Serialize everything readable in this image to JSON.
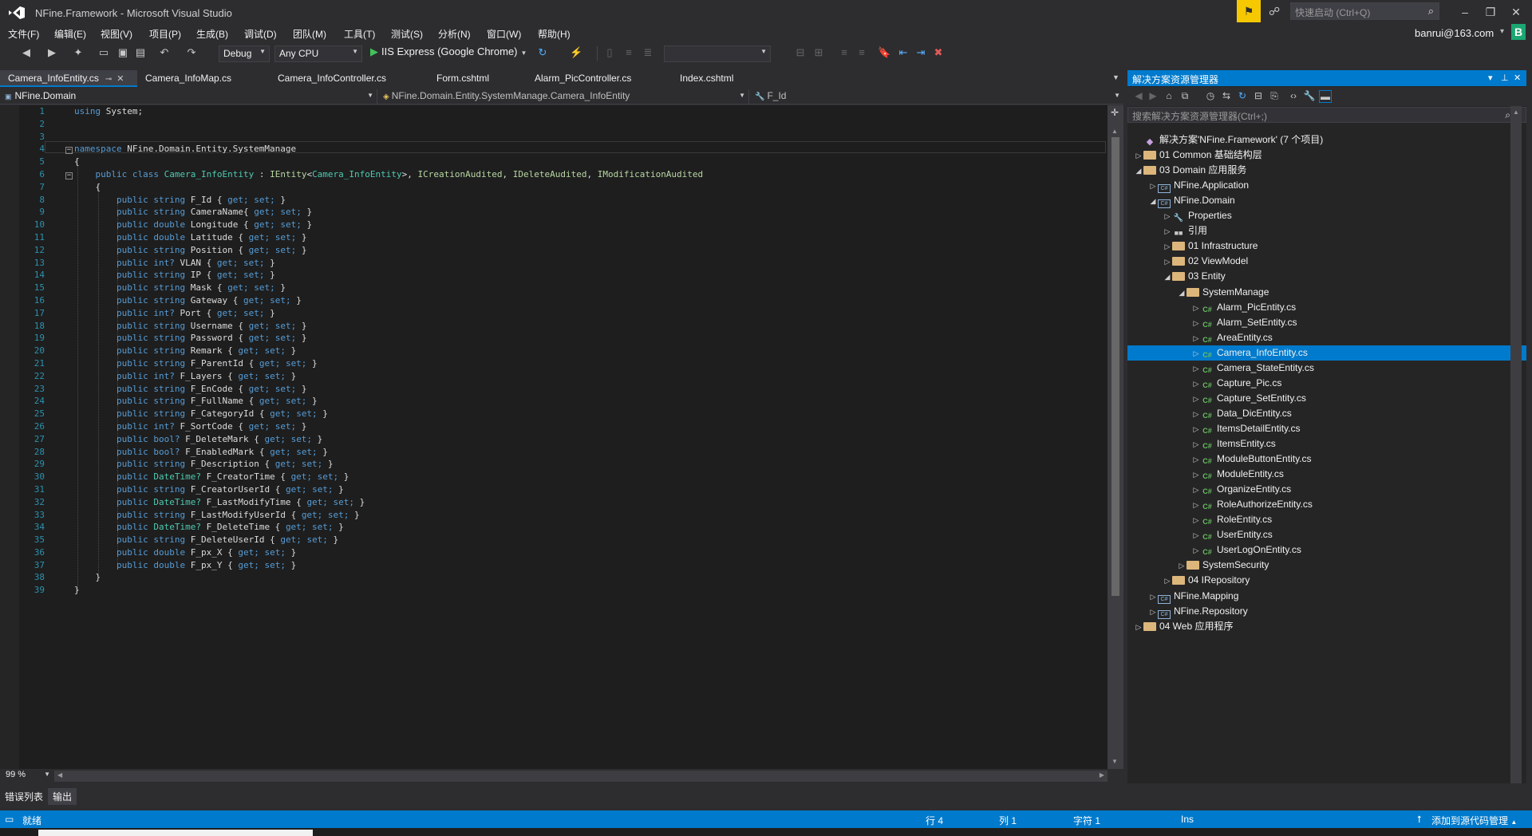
{
  "window": {
    "title": "NFine.Framework - Microsoft Visual Studio",
    "quick_launch_placeholder": "快速启动 (Ctrl+Q)",
    "account": "banrui@163.com",
    "avatar_letter": "B"
  },
  "menu": [
    "文件(F)",
    "编辑(E)",
    "视图(V)",
    "项目(P)",
    "生成(B)",
    "调试(D)",
    "团队(M)",
    "工具(T)",
    "测试(S)",
    "分析(N)",
    "窗口(W)",
    "帮助(H)"
  ],
  "toolbar": {
    "config": "Debug",
    "platform": "Any CPU",
    "run_target": "IIS Express (Google Chrome)"
  },
  "tabs": [
    "Camera_InfoEntity.cs",
    "Camera_InfoMap.cs",
    "Camera_InfoController.cs",
    "Form.cshtml",
    "Alarm_PicController.cs",
    "Index.cshtml"
  ],
  "navbar": {
    "project": "NFine.Domain",
    "type": "NFine.Domain.Entity.SystemManage.Camera_InfoEntity",
    "member": "F_Id"
  },
  "code": {
    "line_numbers": [
      "1",
      "2",
      "3",
      "4",
      "5",
      "6",
      "7",
      "8",
      "9",
      "10",
      "11",
      "12",
      "13",
      "14",
      "15",
      "16",
      "17",
      "18",
      "19",
      "20",
      "21",
      "22",
      "23",
      "24",
      "25",
      "26",
      "27",
      "28",
      "29",
      "30",
      "31",
      "32",
      "33",
      "34",
      "35",
      "36",
      "37",
      "38",
      "39"
    ],
    "using_kw": "using",
    "using_rest": " System;",
    "ns_kw": "namespace",
    "ns_name": " NFine.Domain.Entity.SystemManage",
    "open_brace": "{",
    "close_brace": "}",
    "class_mod": "public class",
    "class_name": "Camera_InfoEntity",
    "class_colon": " : ",
    "i_entity": "IEntity",
    "generic_open": "<",
    "generic_arg": "Camera_InfoEntity",
    "generic_close": ">, ",
    "i_creation": "ICreationAudited",
    "comma1": ", ",
    "i_delete": "IDeleteAudited",
    "comma2": ", ",
    "i_modification": "IModificationAudited",
    "properties": [
      {
        "type": "string",
        "name": "F_Id { ",
        "accessors": "get; set;",
        "end": " }"
      },
      {
        "type": "string",
        "name": "CameraName{ ",
        "accessors": "get; set;",
        "end": " }"
      },
      {
        "type": "double",
        "name": "Longitude { ",
        "accessors": "get; set;",
        "end": " }"
      },
      {
        "type": "double",
        "name": "Latitude { ",
        "accessors": "get; set;",
        "end": " }"
      },
      {
        "type": "string",
        "name": "Position { ",
        "accessors": "get; set;",
        "end": " }"
      },
      {
        "type": "int?",
        "name": "VLAN { ",
        "accessors": "get; set;",
        "end": " }"
      },
      {
        "type": "string",
        "name": "IP { ",
        "accessors": "get; set;",
        "end": " }"
      },
      {
        "type": "string",
        "name": "Mask { ",
        "accessors": "get; set;",
        "end": " }"
      },
      {
        "type": "string",
        "name": "Gateway { ",
        "accessors": "get; set;",
        "end": " }"
      },
      {
        "type": "int?",
        "name": "Port { ",
        "accessors": "get; set;",
        "end": " }"
      },
      {
        "type": "string",
        "name": "Username { ",
        "accessors": "get; set;",
        "end": " }"
      },
      {
        "type": "string",
        "name": "Password { ",
        "accessors": "get; set;",
        "end": " }"
      },
      {
        "type": "string",
        "name": "Remark { ",
        "accessors": "get; set;",
        "end": " }"
      },
      {
        "type": "string",
        "name": "F_ParentId { ",
        "accessors": "get; set;",
        "end": " }"
      },
      {
        "type": "int?",
        "name": "F_Layers { ",
        "accessors": "get; set;",
        "end": " }"
      },
      {
        "type": "string",
        "name": "F_EnCode { ",
        "accessors": "get; set;",
        "end": " }"
      },
      {
        "type": "string",
        "name": "F_FullName { ",
        "accessors": "get; set;",
        "end": " }"
      },
      {
        "type": "string",
        "name": "F_CategoryId { ",
        "accessors": "get; set;",
        "end": " }"
      },
      {
        "type": "int?",
        "name": "F_SortCode { ",
        "accessors": "get; set;",
        "end": " }"
      },
      {
        "type": "bool?",
        "name": "F_DeleteMark { ",
        "accessors": "get; set;",
        "end": " }"
      },
      {
        "type": "bool?",
        "name": "F_EnabledMark { ",
        "accessors": "get; set;",
        "end": " }"
      },
      {
        "type": "string",
        "name": "F_Description { ",
        "accessors": "get; set;",
        "end": " }"
      },
      {
        "type": "DateTime?",
        "name": "F_CreatorTime { ",
        "accessors": "get; set;",
        "end": " }"
      },
      {
        "type": "string",
        "name": "F_CreatorUserId { ",
        "accessors": "get; set;",
        "end": " }"
      },
      {
        "type": "DateTime?",
        "name": "F_LastModifyTime { ",
        "accessors": "get; set;",
        "end": " }"
      },
      {
        "type": "string",
        "name": "F_LastModifyUserId { ",
        "accessors": "get; set;",
        "end": " }"
      },
      {
        "type": "DateTime?",
        "name": "F_DeleteTime { ",
        "accessors": "get; set;",
        "end": " }"
      },
      {
        "type": "string",
        "name": "F_DeleteUserId { ",
        "accessors": "get; set;",
        "end": " }"
      },
      {
        "type": "double",
        "name": "F_px_X { ",
        "accessors": "get; set;",
        "end": " }"
      },
      {
        "type": "double",
        "name": "F_px_Y { ",
        "accessors": "get; set;",
        "end": " }"
      }
    ],
    "public_kw": "public"
  },
  "zoom": "99 %",
  "bottom_tabs": [
    "错误列表",
    "输出"
  ],
  "solution_explorer": {
    "title": "解决方案资源管理器",
    "search_placeholder": "搜索解决方案资源管理器(Ctrl+;)",
    "tree": [
      {
        "label": "解决方案'NFine.Framework' (7 个项目)",
        "icon": "solution-icon"
      },
      {
        "label": "01 Common 基础结构层",
        "icon": "folder-icon"
      },
      {
        "label": "03 Domain 应用服务",
        "icon": "folder-open-icon"
      },
      {
        "label": "NFine.Application",
        "icon": "csproj-icon"
      },
      {
        "label": "NFine.Domain",
        "icon": "csproj-icon"
      },
      {
        "label": "Properties",
        "icon": "wrench-icon"
      },
      {
        "label": "引用",
        "icon": "references-icon"
      },
      {
        "label": "01 Infrastructure",
        "icon": "folder-icon"
      },
      {
        "label": "02 ViewModel",
        "icon": "folder-icon"
      },
      {
        "label": "03 Entity",
        "icon": "folder-open-icon"
      },
      {
        "label": "SystemManage",
        "icon": "folder-open-icon"
      },
      {
        "label": "Alarm_PicEntity.cs",
        "icon": "csharp-file-icon"
      },
      {
        "label": "Alarm_SetEntity.cs",
        "icon": "csharp-file-icon"
      },
      {
        "label": "AreaEntity.cs",
        "icon": "csharp-file-icon"
      },
      {
        "label": "Camera_InfoEntity.cs",
        "icon": "csharp-file-icon"
      },
      {
        "label": "Camera_StateEntity.cs",
        "icon": "csharp-file-icon"
      },
      {
        "label": "Capture_Pic.cs",
        "icon": "csharp-file-icon"
      },
      {
        "label": "Capture_SetEntity.cs",
        "icon": "csharp-file-icon"
      },
      {
        "label": "Data_DicEntity.cs",
        "icon": "csharp-file-icon"
      },
      {
        "label": "ItemsDetailEntity.cs",
        "icon": "csharp-file-icon"
      },
      {
        "label": "ItemsEntity.cs",
        "icon": "csharp-file-icon"
      },
      {
        "label": "ModuleButtonEntity.cs",
        "icon": "csharp-file-icon"
      },
      {
        "label": "ModuleEntity.cs",
        "icon": "csharp-file-icon"
      },
      {
        "label": "OrganizeEntity.cs",
        "icon": "csharp-file-icon"
      },
      {
        "label": "RoleAuthorizeEntity.cs",
        "icon": "csharp-file-icon"
      },
      {
        "label": "RoleEntity.cs",
        "icon": "csharp-file-icon"
      },
      {
        "label": "UserEntity.cs",
        "icon": "csharp-file-icon"
      },
      {
        "label": "UserLogOnEntity.cs",
        "icon": "csharp-file-icon"
      },
      {
        "label": "SystemSecurity",
        "icon": "folder-icon"
      },
      {
        "label": "04 IRepository",
        "icon": "folder-icon"
      },
      {
        "label": "NFine.Mapping",
        "icon": "csproj-icon"
      },
      {
        "label": "NFine.Repository",
        "icon": "csproj-icon"
      },
      {
        "label": "04 Web 应用程序",
        "icon": "folder-icon"
      }
    ]
  },
  "status": {
    "ready": "就绪",
    "line": "行 4",
    "col": "列 1",
    "char": "字符 1",
    "mode": "Ins",
    "source_control": "添加到源代码管理"
  },
  "colors": {
    "accent": "#007acc",
    "keyword": "#569cd6",
    "type": "#4ec9b0",
    "interface": "#b8d7a3",
    "line_number": "#2b91af"
  }
}
